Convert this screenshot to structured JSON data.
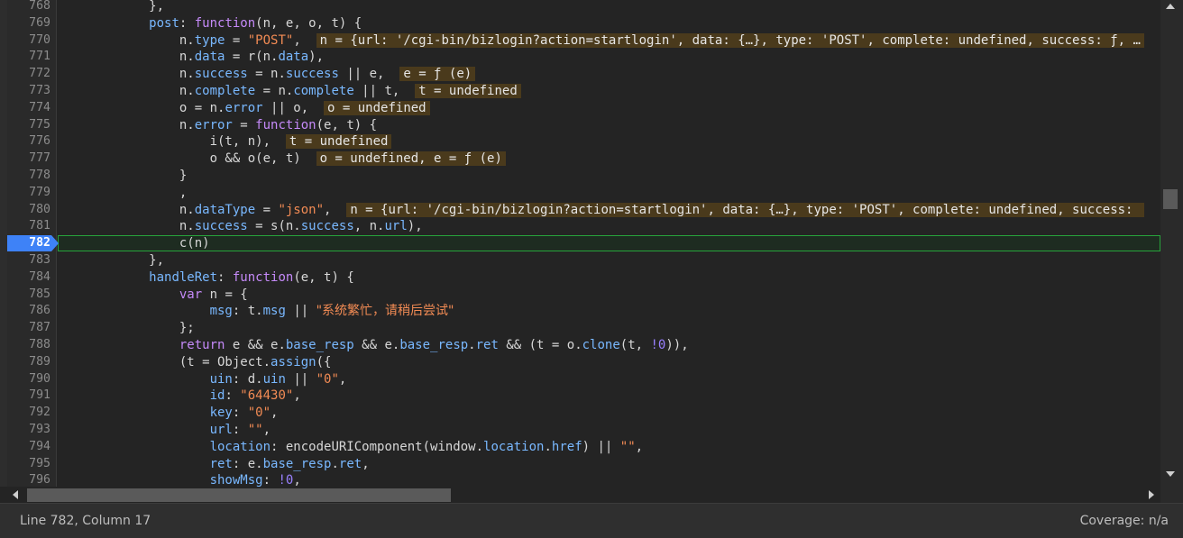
{
  "editor": {
    "breakpoint_line": "782",
    "lines": [
      {
        "num": "768",
        "text": "            },"
      },
      {
        "num": "769",
        "text": "            post: function(n, e, o, t) {"
      },
      {
        "num": "770",
        "text": "                n.type = \"POST\",  n = {url: '/cgi-bin/bizlogin?action=startlogin', data: {…}, type: 'POST', complete: undefined, success: ƒ, …"
      },
      {
        "num": "771",
        "text": "                n.data = r(n.data),"
      },
      {
        "num": "772",
        "text": "                n.success = n.success || e,  e = ƒ (e)"
      },
      {
        "num": "773",
        "text": "                n.complete = n.complete || t,  t = undefined"
      },
      {
        "num": "774",
        "text": "                o = n.error || o,  o = undefined"
      },
      {
        "num": "775",
        "text": "                n.error = function(e, t) {"
      },
      {
        "num": "776",
        "text": "                    i(t, n),  t = undefined"
      },
      {
        "num": "777",
        "text": "                    o && o(e, t)  o = undefined, e = ƒ (e)"
      },
      {
        "num": "778",
        "text": "                }"
      },
      {
        "num": "779",
        "text": "                ,"
      },
      {
        "num": "780",
        "text": "                n.dataType = \"json\",  n = {url: '/cgi-bin/bizlogin?action=startlogin', data: {…}, type: 'POST', complete: undefined, success: "
      },
      {
        "num": "781",
        "text": "                n.success = s(n.success, n.url),"
      },
      {
        "num": "782",
        "text": "                c(n)"
      },
      {
        "num": "783",
        "text": "            },"
      },
      {
        "num": "784",
        "text": "            handleRet: function(e, t) {"
      },
      {
        "num": "785",
        "text": "                var n = {"
      },
      {
        "num": "786",
        "text": "                    msg: t.msg || \"系统繁忙，请稍后尝试\""
      },
      {
        "num": "787",
        "text": "                };"
      },
      {
        "num": "788",
        "text": "                return e && e.base_resp && e.base_resp.ret && (t = o.clone(t, !0)),"
      },
      {
        "num": "789",
        "text": "                (t = Object.assign({"
      },
      {
        "num": "790",
        "text": "                    uin: d.uin || \"0\","
      },
      {
        "num": "791",
        "text": "                    id: \"64430\","
      },
      {
        "num": "792",
        "text": "                    key: \"0\","
      },
      {
        "num": "793",
        "text": "                    url: \"\","
      },
      {
        "num": "794",
        "text": "                    location: encodeURIComponent(window.location.href) || \"\","
      },
      {
        "num": "795",
        "text": "                    ret: e.base_resp.ret,"
      },
      {
        "num": "796",
        "text": "                    showMsg: !0,"
      }
    ]
  },
  "statusbar": {
    "position": "Line 782, Column 17",
    "coverage": "Coverage: n/a"
  },
  "colors": {
    "keyword": "#c58af9",
    "property": "#79b8ff",
    "string": "#f28b54",
    "number": "#9980ff",
    "breakpoint": "#3e82f7",
    "active_line_border": "#27a33b",
    "inline_value_bg": "#4a3a1c"
  }
}
